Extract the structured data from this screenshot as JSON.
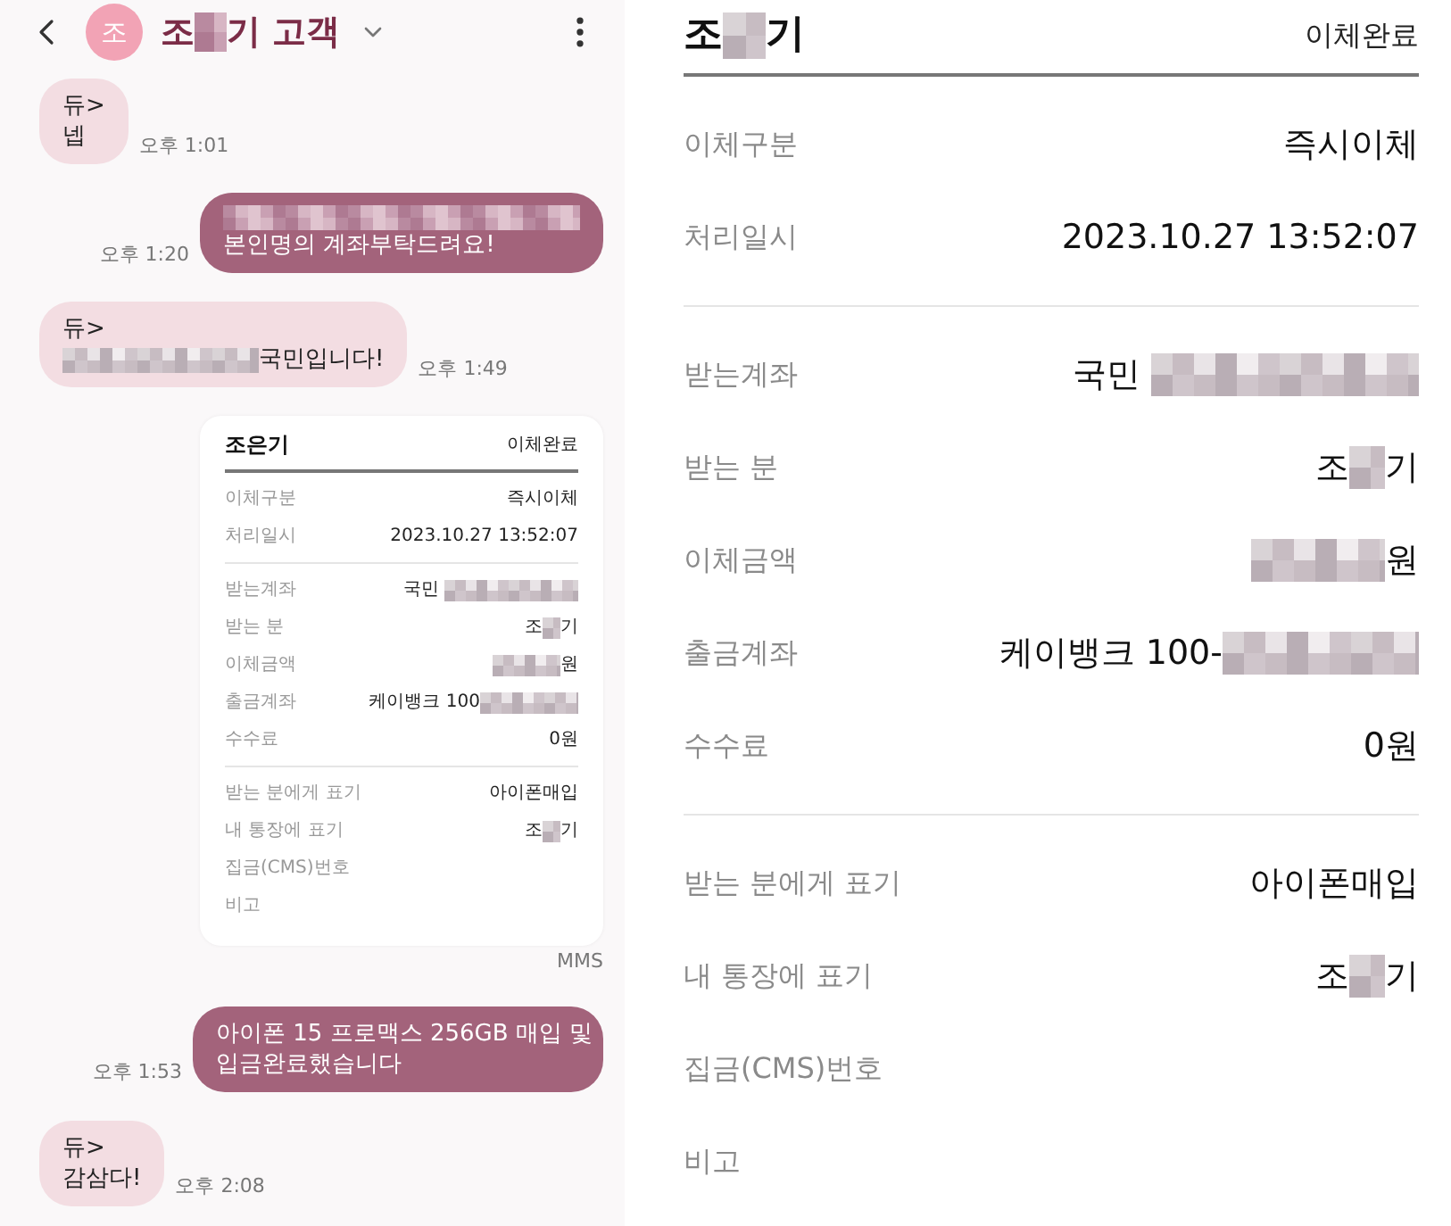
{
  "chat": {
    "header": {
      "avatar_letter": "조",
      "title": [
        "조",
        {
          "kind": "redacted"
        },
        "기 고객"
      ]
    },
    "messages": [
      {
        "kind": "text",
        "sent": false,
        "lines": [
          [
            "듀>"
          ],
          [
            "넵"
          ]
        ],
        "time": "오후 1:01"
      },
      {
        "kind": "text",
        "sent": true,
        "lines": [
          [
            {
              "kind": "redacted"
            }
          ],
          [
            "본인명의 계좌부탁드려요!"
          ]
        ],
        "time": "오후 1:20"
      },
      {
        "kind": "text",
        "sent": false,
        "lines": [
          [
            "듀>"
          ],
          [
            {
              "kind": "redacted"
            },
            "국민입니다!"
          ]
        ],
        "time": "오후 1:49"
      },
      {
        "kind": "receipt",
        "label": "MMS",
        "receipt": {
          "title": [
            "조은기"
          ],
          "status": "이체완료",
          "sections": [
            [
              {
                "label": "이체구분",
                "value": [
                  "즉시이체"
                ]
              },
              {
                "label": "처리일시",
                "value": [
                  "2023.10.27 13:52:07"
                ]
              }
            ],
            [
              {
                "label": "받는계좌",
                "value": [
                  "국민 ",
                  {
                    "kind": "redacted"
                  }
                ]
              },
              {
                "label": "받는 분",
                "value": [
                  "조",
                  {
                    "kind": "redacted"
                  },
                  "기"
                ]
              },
              {
                "label": "이체금액",
                "value": [
                  {
                    "kind": "redacted"
                  },
                  "원"
                ]
              },
              {
                "label": "출금계좌",
                "value": [
                  "케이뱅크 100",
                  {
                    "kind": "redacted"
                  }
                ]
              },
              {
                "label": "수수료",
                "value": [
                  "0원"
                ]
              }
            ],
            [
              {
                "label": "받는 분에게 표기",
                "value": [
                  "아이폰매입"
                ]
              },
              {
                "label": "내 통장에 표기",
                "value": [
                  "조",
                  {
                    "kind": "redacted"
                  },
                  "기"
                ]
              },
              {
                "label": "집금(CMS)번호"
              },
              {
                "label": "비고"
              }
            ]
          ]
        }
      },
      {
        "kind": "text",
        "sent": true,
        "lines": [
          [
            "아이폰 15 프로맥스 256GB 매입 및"
          ],
          [
            "입금완료했습니다"
          ]
        ],
        "time": "오후 1:53"
      },
      {
        "kind": "text",
        "sent": false,
        "lines": [
          [
            "듀>"
          ],
          [
            "감삼다!"
          ]
        ],
        "time": "오후 2:08"
      }
    ]
  },
  "detail": {
    "title": [
      "조",
      {
        "kind": "redacted"
      },
      "기"
    ],
    "status": "이체완료",
    "sections": [
      [
        {
          "label": "이체구분",
          "value": [
            "즉시이체"
          ]
        },
        {
          "label": "처리일시",
          "value": [
            "2023.10.27 13:52:07"
          ]
        }
      ],
      [
        {
          "label": "받는계좌",
          "value": [
            "국민 ",
            {
              "kind": "redacted"
            }
          ]
        },
        {
          "label": "받는 분",
          "value": [
            "조",
            {
              "kind": "redacted"
            },
            "기"
          ]
        },
        {
          "label": "이체금액",
          "value": [
            {
              "kind": "redacted"
            },
            "원"
          ]
        },
        {
          "label": "출금계좌",
          "value": [
            "케이뱅크 100-",
            {
              "kind": "redacted"
            }
          ]
        },
        {
          "label": "수수료",
          "value": [
            "0원"
          ]
        }
      ],
      [
        {
          "label": "받는 분에게 표기",
          "value": [
            "아이폰매입"
          ]
        },
        {
          "label": "내 통장에 표기",
          "value": [
            "조",
            {
              "kind": "redacted"
            },
            "기"
          ]
        },
        {
          "label": "집금(CMS)번호"
        },
        {
          "label": "비고"
        }
      ]
    ]
  }
}
